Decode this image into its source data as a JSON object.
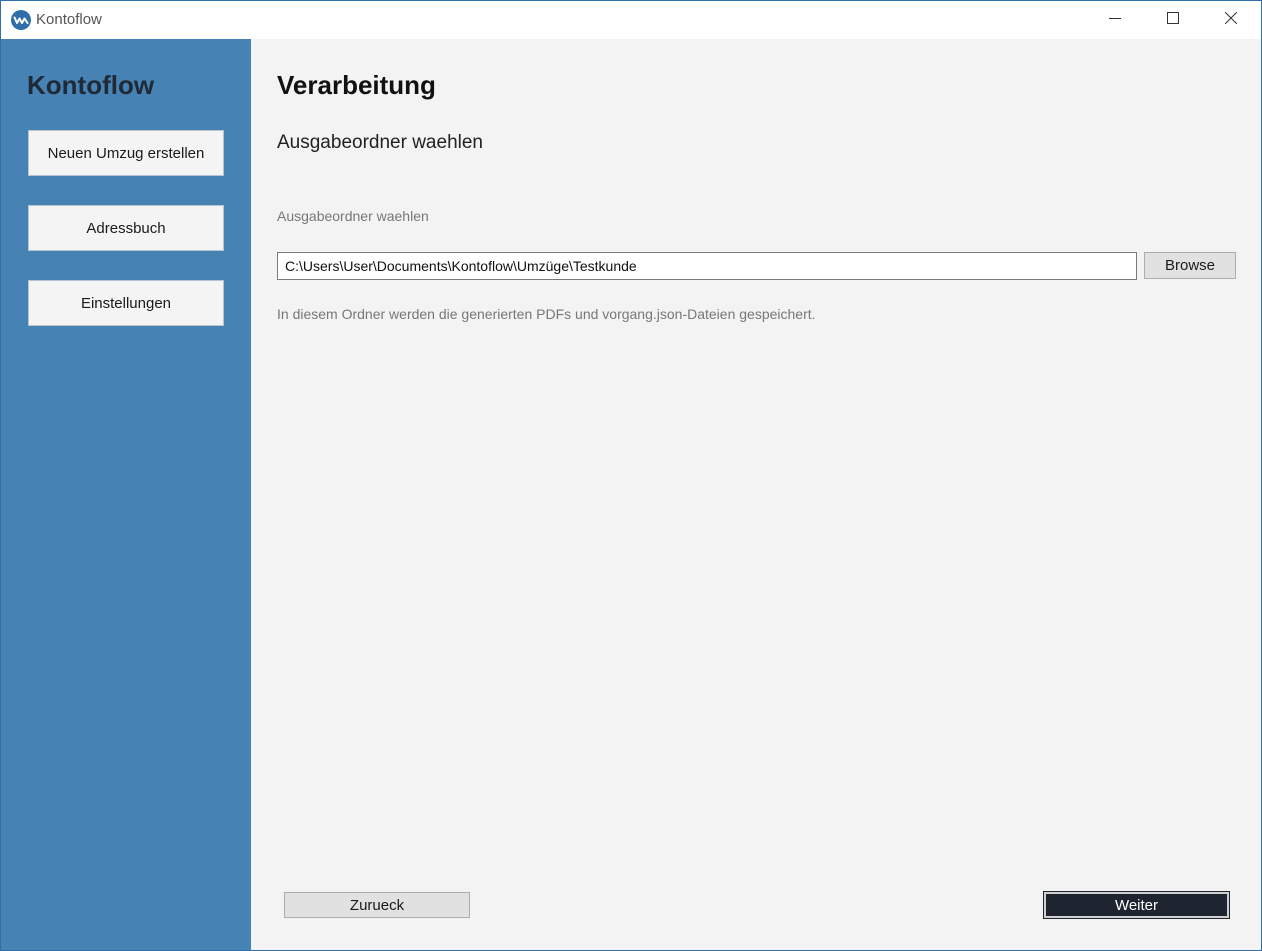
{
  "window": {
    "title": "Kontoflow",
    "app_icon": "kontoflow-logo-icon",
    "controls": [
      "minimize-icon",
      "maximize-icon",
      "close-icon"
    ]
  },
  "sidebar": {
    "title": "Kontoflow",
    "items": [
      {
        "label": "Neuen Umzug erstellen"
      },
      {
        "label": "Adressbuch"
      },
      {
        "label": "Einstellungen"
      }
    ]
  },
  "main": {
    "title": "Verarbeitung",
    "section_title": "Ausgabeordner waehlen",
    "field_label": "Ausgabeordner waehlen",
    "path_value": "C:\\Users\\User\\Documents\\Kontoflow\\Umzüge\\Testkunde",
    "browse_label": "Browse",
    "hint": "In diesem Ordner werden die generierten PDFs und vorgang.json-Dateien gespeichert.",
    "back_label": "Zurueck",
    "next_label": "Weiter"
  },
  "colors": {
    "sidebar_bg": "#4682b4",
    "primary_button_bg": "#1e2530",
    "content_bg": "#f3f3f3"
  }
}
